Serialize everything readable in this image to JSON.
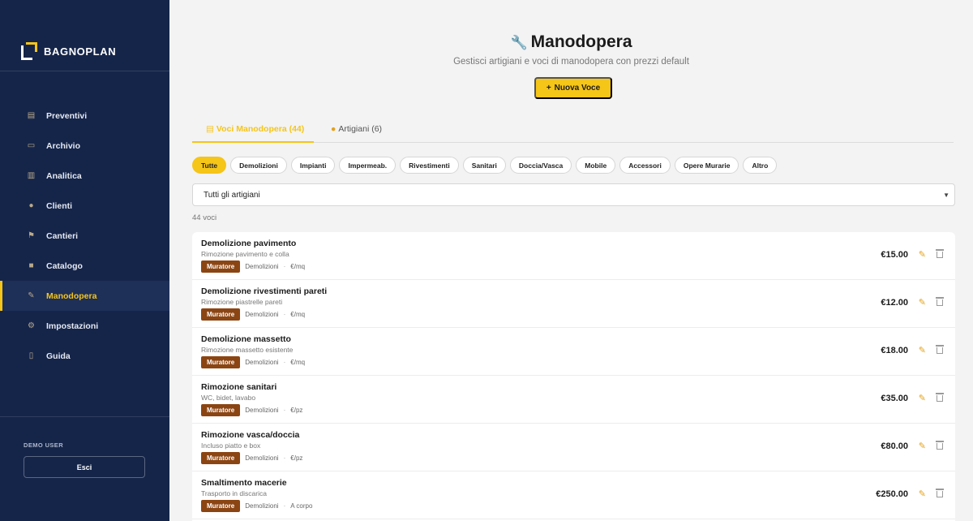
{
  "app": {
    "name": "BAGNOPLAN"
  },
  "sidebar": {
    "items": [
      {
        "label": "Preventivi",
        "icon": "clipboard-icon"
      },
      {
        "label": "Archivio",
        "icon": "folder-icon"
      },
      {
        "label": "Analitica",
        "icon": "chart-icon"
      },
      {
        "label": "Clienti",
        "icon": "users-icon"
      },
      {
        "label": "Cantieri",
        "icon": "flag-icon"
      },
      {
        "label": "Catalogo",
        "icon": "box-icon"
      },
      {
        "label": "Manodopera",
        "icon": "wrench-icon",
        "active": true
      },
      {
        "label": "Impostazioni",
        "icon": "gear-icon"
      },
      {
        "label": "Guida",
        "icon": "book-icon"
      }
    ],
    "user_label": "DEMO USER",
    "logout_label": "Esci"
  },
  "header": {
    "title": "Manodopera",
    "subtitle": "Gestisci artigiani e voci di manodopera con prezzi default",
    "new_button": "Nuova Voce"
  },
  "tabs": [
    {
      "label": "Voci Manodopera (44)",
      "active": true
    },
    {
      "label": "Artigiani (6)",
      "active": false
    }
  ],
  "filters": [
    "Tutte",
    "Demolizioni",
    "Impianti",
    "Impermeab.",
    "Rivestimenti",
    "Sanitari",
    "Doccia/Vasca",
    "Mobile",
    "Accessori",
    "Opere Murarie",
    "Altro"
  ],
  "active_filter": "Tutte",
  "artisan_select": {
    "value": "Tutti gli artigiani"
  },
  "count_label": "44 voci",
  "items": [
    {
      "name": "Demolizione pavimento",
      "desc": "Rimozione pavimento e colla",
      "artisan": "Muratore",
      "category": "Demolizioni",
      "unit": "€/mq",
      "price": "€15.00"
    },
    {
      "name": "Demolizione rivestimenti pareti",
      "desc": "Rimozione piastrelle pareti",
      "artisan": "Muratore",
      "category": "Demolizioni",
      "unit": "€/mq",
      "price": "€12.00"
    },
    {
      "name": "Demolizione massetto",
      "desc": "Rimozione massetto esistente",
      "artisan": "Muratore",
      "category": "Demolizioni",
      "unit": "€/mq",
      "price": "€18.00"
    },
    {
      "name": "Rimozione sanitari",
      "desc": "WC, bidet, lavabo",
      "artisan": "Muratore",
      "category": "Demolizioni",
      "unit": "€/pz",
      "price": "€35.00"
    },
    {
      "name": "Rimozione vasca/doccia",
      "desc": "Incluso piatto e box",
      "artisan": "Muratore",
      "category": "Demolizioni",
      "unit": "€/pz",
      "price": "€80.00"
    },
    {
      "name": "Smaltimento macerie",
      "desc": "Trasporto in discarica",
      "artisan": "Muratore",
      "category": "Demolizioni",
      "unit": "A corpo",
      "price": "€250.00"
    }
  ],
  "colors": {
    "sidebar_bg": "#15254a",
    "accent": "#f5c518",
    "badge": "#8b4513"
  }
}
